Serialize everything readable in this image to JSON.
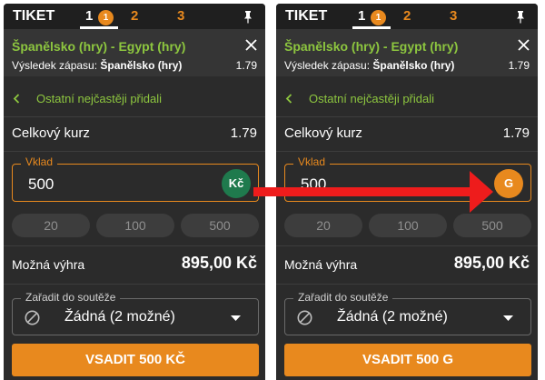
{
  "colors": {
    "accent": "#e8891e",
    "match_green": "#8dc63f",
    "kc_badge": "#1f7a4d",
    "arrow": "#ee1c1c"
  },
  "panels": [
    {
      "title": "TIKET",
      "tabs": [
        {
          "label": "1",
          "badge": "1",
          "active": true
        },
        {
          "label": "2"
        },
        {
          "label": "3"
        }
      ],
      "match": {
        "name": "Španělsko (hry) - Egypt (hry)",
        "market_label": "Výsledek zápasu:",
        "selection": "Španělsko (hry)",
        "odds": "1.79"
      },
      "others_label": "Ostatní nejčastěji přidali",
      "total_odds_label": "Celkový kurz",
      "total_odds": "1.79",
      "stake": {
        "label": "Vklad",
        "value": "500",
        "currency": "Kč"
      },
      "quick_amounts": [
        "20",
        "100",
        "500"
      ],
      "win": {
        "label": "Možná výhra",
        "value": "895,00 Kč"
      },
      "competition": {
        "label": "Zařadit do soutěže",
        "value": "Žádná (2 možné)"
      },
      "bet_button": "VSADIT 500 KČ"
    },
    {
      "title": "TIKET",
      "tabs": [
        {
          "label": "1",
          "badge": "1",
          "active": true
        },
        {
          "label": "2"
        },
        {
          "label": "3"
        }
      ],
      "match": {
        "name": "Španělsko (hry) - Egypt (hry)",
        "market_label": "Výsledek zápasu:",
        "selection": "Španělsko (hry)",
        "odds": "1.79"
      },
      "others_label": "Ostatní nejčastěji přidali",
      "total_odds_label": "Celkový kurz",
      "total_odds": "1.79",
      "stake": {
        "label": "Vklad",
        "value": "500",
        "currency": "G"
      },
      "quick_amounts": [
        "20",
        "100",
        "500"
      ],
      "win": {
        "label": "Možná výhra",
        "value": "895,00 Kč"
      },
      "competition": {
        "label": "Zařadit do soutěže",
        "value": "Žádná (2 možné)"
      },
      "bet_button": "VSADIT 500 G"
    }
  ]
}
